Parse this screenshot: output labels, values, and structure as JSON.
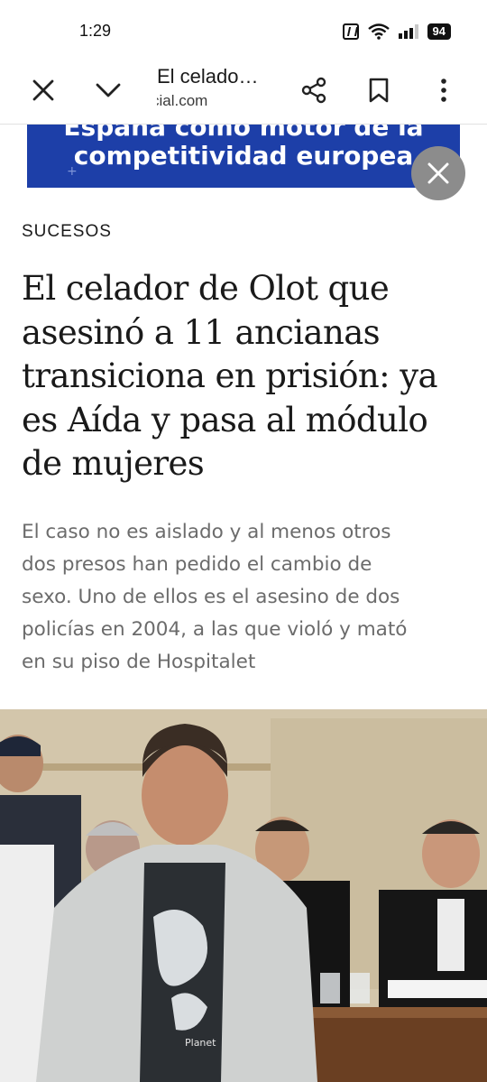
{
  "status_bar": {
    "time": "1:29",
    "battery": "94",
    "icons": [
      "nfc-icon",
      "wifi-icon",
      "signal-icon",
      "battery-icon"
    ]
  },
  "toolbar": {
    "title": "El celado…",
    "url": "cial.com",
    "icons": [
      "close-icon",
      "chevron-down-icon",
      "share-icon",
      "bookmark-icon",
      "more-vert-icon"
    ]
  },
  "ad": {
    "line1": "España como motor de la",
    "line2": "competitividad europea",
    "background": "#1d3fa8",
    "close_icon": "close-icon"
  },
  "article": {
    "section": "SUCESOS",
    "headline_lines": [
      "El celador de Olot que",
      "asesinó a 11 ancianas",
      "transiciona en prisión: ya",
      "es Aída y pasa al módulo",
      "de mujeres"
    ],
    "lede_lines": [
      "El caso no es aislado y al menos otros",
      "dos presos han pedido el cambio de",
      "sexo. Uno de ellos es el asesino de dos",
      "policías en 2004, a las que violó y mató",
      "en su piso de Hospitalet"
    ],
    "photo_label": "Planet"
  }
}
